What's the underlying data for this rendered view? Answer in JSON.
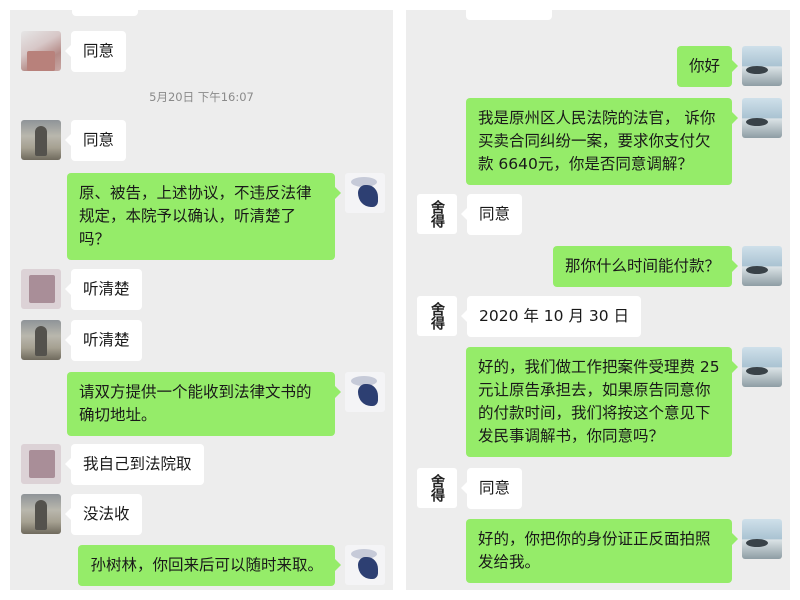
{
  "left_chat": {
    "timestamp": "5月20日 下午16:07",
    "messages": [
      {
        "side": "in",
        "avatar": "pink-photo",
        "text": "同意"
      },
      {
        "side": "in",
        "avatar": "landscape-photo",
        "text": "同意"
      },
      {
        "side": "out",
        "avatar": "ink-painting",
        "text": "原、被告，上述协议，不违反法律规定，本院予以确认，听清楚了吗？"
      },
      {
        "side": "in",
        "avatar": "mauve-photo",
        "text": "听清楚"
      },
      {
        "side": "in",
        "avatar": "landscape-photo",
        "text": "听清楚"
      },
      {
        "side": "out",
        "avatar": "ink-painting",
        "text": "请双方提供一个能收到法律文书的确切地址。"
      },
      {
        "side": "in",
        "avatar": "mauve-photo",
        "text": "我自己到法院取"
      },
      {
        "side": "in",
        "avatar": "landscape-photo",
        "text": "没法收"
      },
      {
        "side": "out",
        "avatar": "ink-painting",
        "text": "孙树林，你回来后可以随时来取。"
      }
    ]
  },
  "right_chat": {
    "messages": [
      {
        "side": "out",
        "avatar": "seaside-photo",
        "text": "你好"
      },
      {
        "side": "out",
        "avatar": "seaside-photo",
        "text": "我是原州区人民法院的法官，        诉你买卖合同纠纷一案，要求你支付欠款 6640元，你是否同意调解？"
      },
      {
        "side": "in",
        "avatar": "calligraphy",
        "text": "同意"
      },
      {
        "side": "out",
        "avatar": "seaside-photo",
        "text": "那你什么时间能付款？"
      },
      {
        "side": "in",
        "avatar": "calligraphy",
        "text": "2020 年 10 月 30 日"
      },
      {
        "side": "out",
        "avatar": "seaside-photo",
        "text": "好的，我们做工作把案件受理费 25 元让原告承担去，如果原告同意你的付款时间，我们将按这个意见下发民事调解书，你同意吗？"
      },
      {
        "side": "in",
        "avatar": "calligraphy",
        "text": "同意"
      },
      {
        "side": "out",
        "avatar": "seaside-photo",
        "text": "好的，你把你的身份证正反面拍照发给我。"
      }
    ],
    "calligraphy_avatar_text": "舍得"
  }
}
